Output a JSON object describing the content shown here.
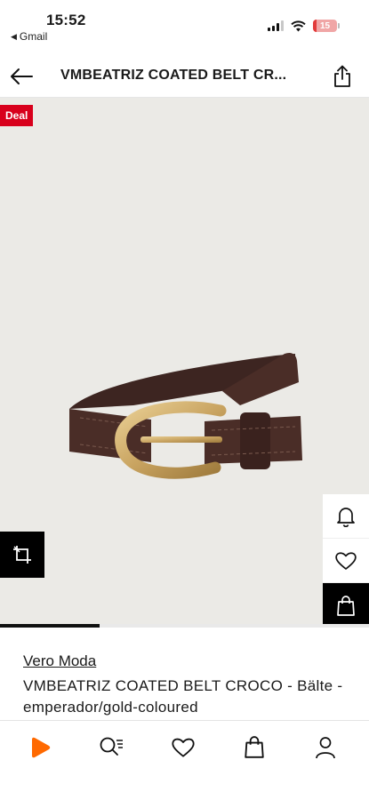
{
  "status": {
    "time": "15:52",
    "back_app": "Gmail",
    "battery": "15",
    "battery_level": 0.15
  },
  "header": {
    "title": "VMBEATRIZ COATED BELT CR...",
    "back_icon": "arrow-left-icon",
    "share_icon": "share-icon"
  },
  "product": {
    "deal_badge": "Deal",
    "brand": "Vero Moda",
    "name": "VMBEATRIZ COATED BELT CROCO - Bälte - emperador/gold-coloured",
    "image_progress": 0.27
  },
  "side_actions": {
    "icons": [
      "bell-icon",
      "heart-icon",
      "shopping-bag-icon"
    ]
  },
  "nav": {
    "items": [
      "home-icon",
      "search-icon",
      "wishlist-icon",
      "cart-icon",
      "profile-icon"
    ]
  },
  "colors": {
    "accent": "#ff6900",
    "deal": "#d8001c",
    "image_background": "#ebeae6"
  }
}
